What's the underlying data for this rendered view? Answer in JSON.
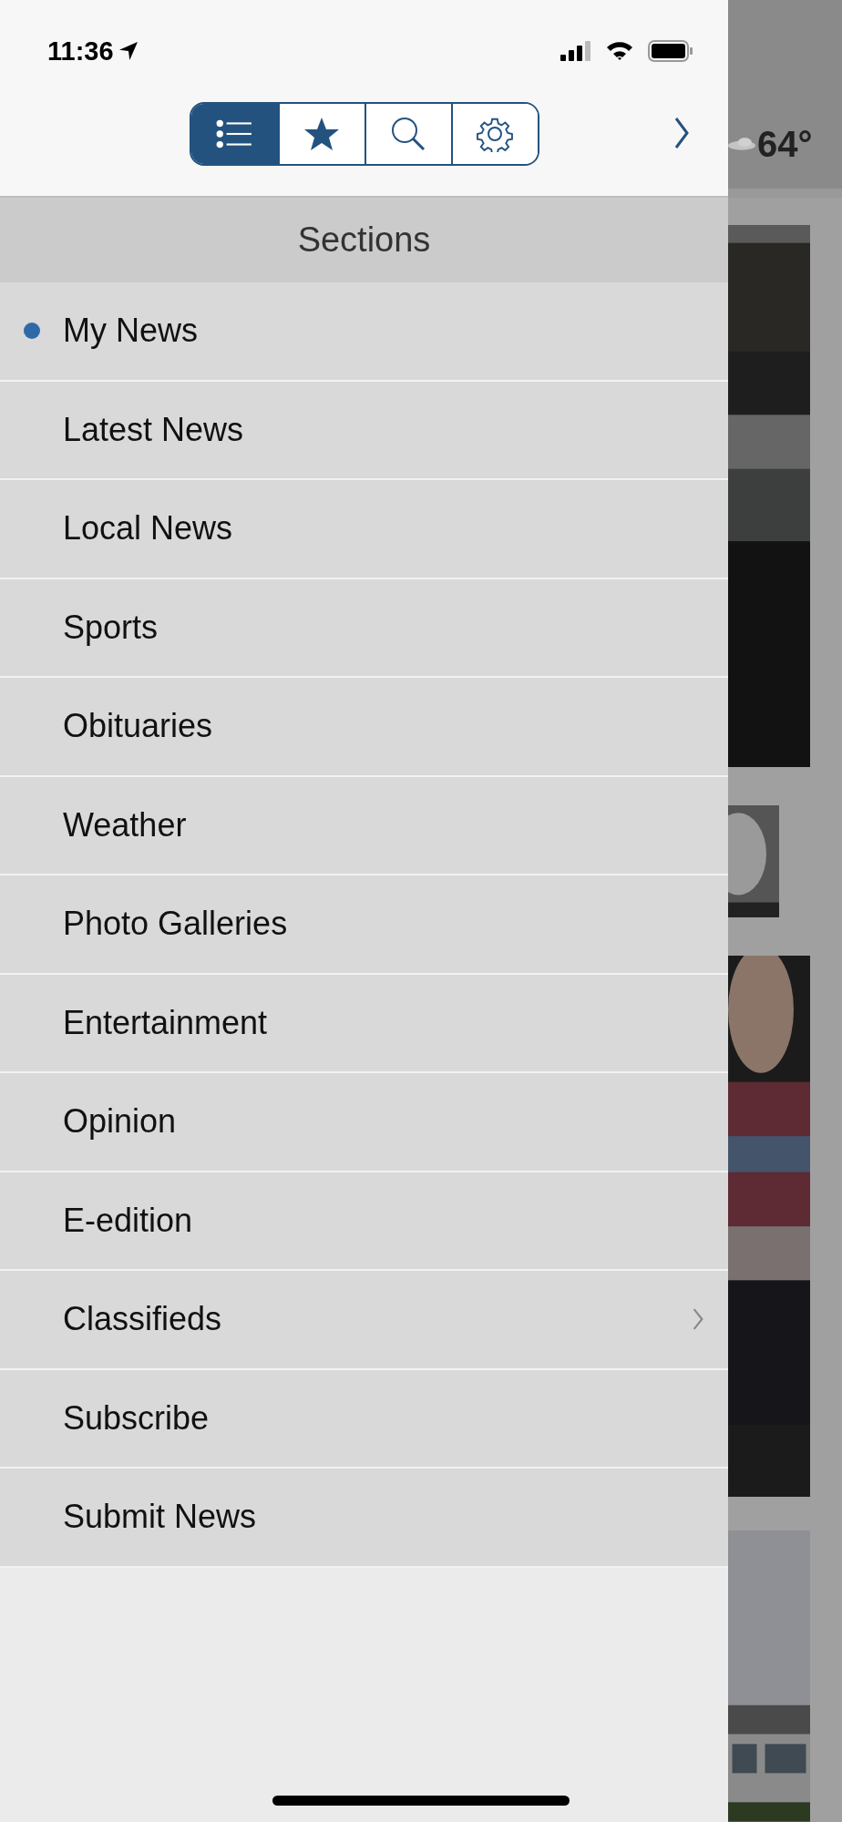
{
  "status_bar": {
    "time": "11:36"
  },
  "toolbar": {
    "segments": [
      {
        "selected": true
      },
      {
        "selected": false
      },
      {
        "selected": false
      },
      {
        "selected": false
      }
    ]
  },
  "sections": {
    "title": "Sections",
    "items": [
      {
        "label": "My News",
        "selected": true,
        "kind": "plain"
      },
      {
        "label": "Latest News",
        "selected": false,
        "kind": "plain"
      },
      {
        "label": "Local News",
        "selected": false,
        "kind": "plain"
      },
      {
        "label": "Sports",
        "selected": false,
        "kind": "plain"
      },
      {
        "label": "Obituaries",
        "selected": false,
        "kind": "plain"
      },
      {
        "label": "Weather",
        "selected": false,
        "kind": "plain"
      },
      {
        "label": "Photo Galleries",
        "selected": false,
        "kind": "plain"
      },
      {
        "label": "Entertainment",
        "selected": false,
        "kind": "plain"
      },
      {
        "label": "Opinion",
        "selected": false,
        "kind": "plain"
      },
      {
        "label": "E-edition",
        "selected": false,
        "kind": "plain"
      },
      {
        "label": "Classifieds",
        "selected": false,
        "kind": "submenu"
      },
      {
        "label": "Subscribe",
        "selected": false,
        "kind": "plain"
      },
      {
        "label": "Submit News",
        "selected": false,
        "kind": "plain"
      }
    ]
  },
  "background_page": {
    "temperature": "64°"
  }
}
